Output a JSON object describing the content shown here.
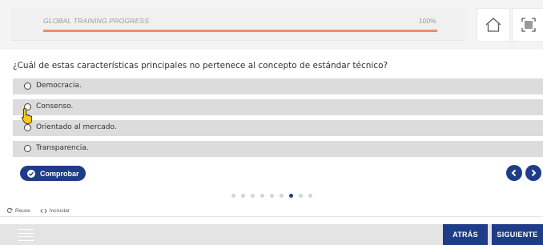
{
  "header": {
    "progress_label": "GLOBAL TRAINING PROGRESS",
    "progress_percent_text": "100%",
    "progress_value": 1.0,
    "accent_color": "#e88f62",
    "home_icon": "home-icon",
    "fullscreen_icon": "fullscreen-icon"
  },
  "question": {
    "text": "¿Cuál de estas características principales no pertenece al concepto de estándar técnico?",
    "options": [
      {
        "label": "Democracia."
      },
      {
        "label": "Consenso."
      },
      {
        "label": "Orientado al mercado."
      },
      {
        "label": "Transparencia."
      }
    ]
  },
  "actions": {
    "check_label": "Comprobar",
    "prev_icon": "chevron-left-icon",
    "next_icon": "chevron-right-icon"
  },
  "pager": {
    "total": 9,
    "current": 7
  },
  "footer": {
    "reuse_label": "Reuse",
    "embed_label": "Incrustar"
  },
  "bottom_nav": {
    "back_label": "ATRÁS",
    "next_label": "SIGUIENTE",
    "brand_color": "#1f3c88"
  }
}
